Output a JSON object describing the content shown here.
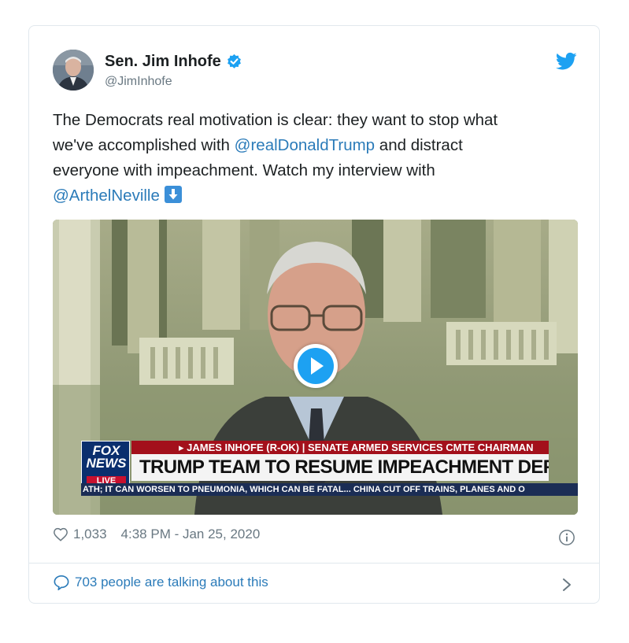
{
  "author": {
    "name": "Sen. Jim Inhofe",
    "handle": "@JimInhofe",
    "verified": true
  },
  "tweet": {
    "line1": "The Democrats real motivation is clear: they want to stop what",
    "line2_pre": "we've accomplished with ",
    "mention1": "@realDonaldTrump",
    "line2_post": " and distract",
    "line3": "everyone with impeachment. Watch my interview with",
    "mention2": "@ArthelNeville"
  },
  "video": {
    "network": "FOX NEWS",
    "live_label": "LIVE",
    "chyron_top": "▸ JAMES INHOFE (R-OK) | SENATE ARMED SERVICES CMTE CHAIRMAN",
    "chyron_main": "TRUMP TEAM TO RESUME IMPEACHMENT DEFENSE MONDAY",
    "ticker": "ATH; IT CAN WORSEN TO PNEUMONIA, WHICH CAN BE FATAL...   CHINA CUT OFF TRAINS, PLANES AND O"
  },
  "meta": {
    "likes": "1,033",
    "timestamp": "4:38 PM - Jan 25, 2020"
  },
  "footer": {
    "talking": "703 people are talking about this"
  },
  "colors": {
    "link": "#2b7bb9",
    "twitter_blue": "#1da1f2",
    "muted": "#697882"
  }
}
